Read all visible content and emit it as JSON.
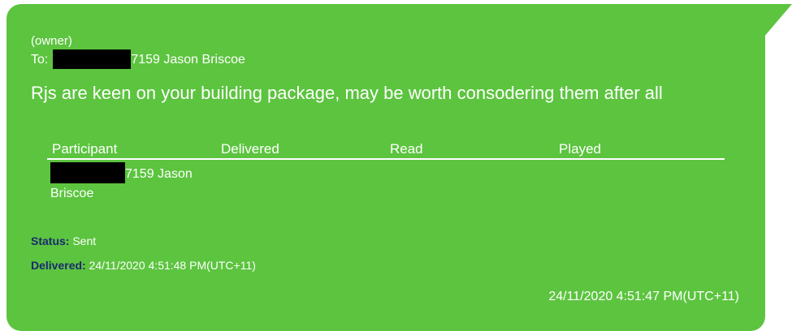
{
  "message": {
    "sender_label": "(owner)",
    "to_prefix": "To:",
    "to_recipient": "7159 Jason Briscoe",
    "body": "Rjs are keen on your building package, may be worth consodering them after all"
  },
  "receipts": {
    "columns": [
      "Participant",
      "Delivered",
      "Read",
      "Played"
    ],
    "rows": [
      {
        "participant_line1": "7159 Jason",
        "participant_line2": "Briscoe",
        "delivered": "",
        "read": "",
        "played": ""
      }
    ]
  },
  "status": {
    "label": "Status:",
    "value": "Sent"
  },
  "delivered": {
    "label": "Delivered:",
    "value": "24/11/2020 4:51:48 PM(UTC+11)"
  },
  "timestamp": "24/11/2020 4:51:47 PM(UTC+11)",
  "colors": {
    "bubble": "#5cc43f",
    "text": "#ffffff",
    "label": "#1a2a6e",
    "redaction": "#000000"
  }
}
